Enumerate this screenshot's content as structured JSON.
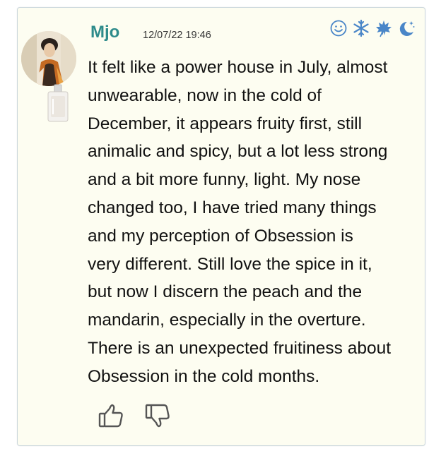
{
  "review": {
    "username": "Mjo",
    "timestamp": "12/07/22 19:46",
    "text": "It felt like a power house in July, almost\nunwearable, now in the cold of\nDecember, it appears fruity first, still\nanimalic and spicy, but a lot less strong\nand a bit more funny, light. My nose\nchanged too, I have tried many things\nand my perception of Obsession is\nvery different. Still love the spice in it,\nbut now I discern the peach and the\nmandarin, especially in the overture.\nThere is an unexpected fruitiness about\nObsession in the cold months."
  },
  "season_icons": [
    "smiley-icon",
    "snowflake-icon",
    "autumn-leaf-icon",
    "moon-stars-icon"
  ],
  "votes": {
    "up_icon": "thumbs-up-icon",
    "down_icon": "thumbs-down-icon"
  },
  "colors": {
    "card_background": "#fdfdf1",
    "card_border": "#c9d6dc",
    "username": "#2e8b8b",
    "icon_blue": "#4a86c8"
  }
}
